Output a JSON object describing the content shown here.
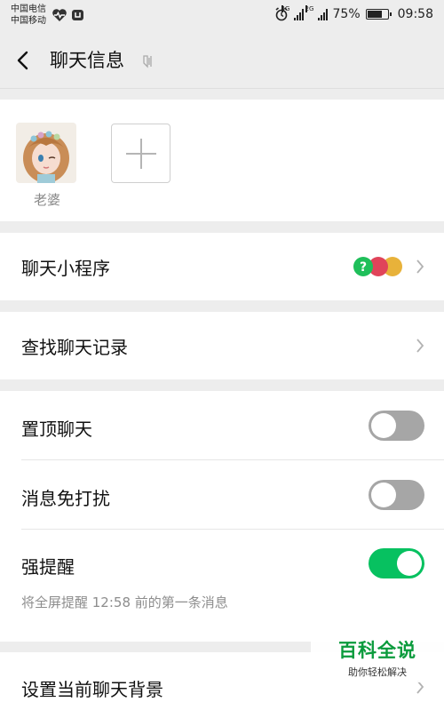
{
  "status_bar": {
    "carrier_1": "中国电信",
    "carrier_2": "中国移动",
    "net_4g": "4G",
    "net_2g": "2G",
    "battery": "75%",
    "battery_level": 0.75,
    "time": "09:58"
  },
  "header": {
    "title": "聊天信息",
    "back_icon": "chevron-left-icon",
    "mute_icon": "mute-icon"
  },
  "members": {
    "items": [
      {
        "name": "老婆"
      }
    ],
    "add_icon": "plus-icon"
  },
  "settings": {
    "mini_programs": "聊天小程序",
    "search_history": "查找聊天记录",
    "pin_chat": "置顶聊天",
    "pin_chat_on": false,
    "do_not_disturb": "消息免打扰",
    "do_not_disturb_on": false,
    "strong_reminder": "强提醒",
    "strong_reminder_on": true,
    "strong_reminder_note": "将全屏提醒 12:58 前的第一条消息",
    "set_background": "设置当前聊天背景"
  },
  "watermark": {
    "title": "百科全说",
    "subtitle": "助你轻松解决"
  },
  "colors": {
    "toggle_on": "#07c160",
    "toggle_off": "#a6a6a6",
    "background": "#ededed",
    "watermark": "#0a9b3c"
  }
}
